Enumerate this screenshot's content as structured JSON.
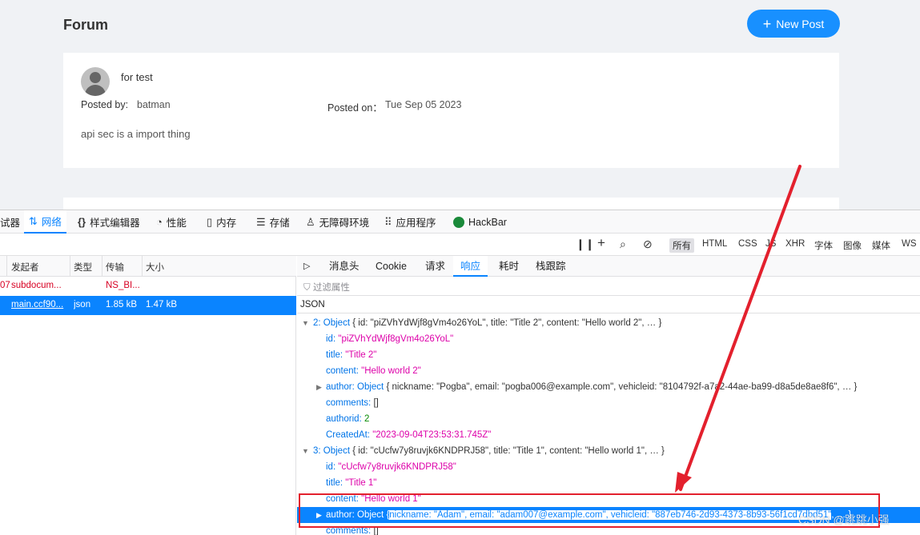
{
  "forum": {
    "title": "Forum",
    "new_post_label": "New Post",
    "post": {
      "title": "for test",
      "posted_by_label": "Posted by:",
      "author": "batman",
      "posted_on_label": "Posted on：",
      "date": "Tue Sep 05 2023",
      "body": "api sec is a import thing"
    }
  },
  "devtools": {
    "tabs": [
      {
        "label": "试器",
        "icon": "debugger-icon"
      },
      {
        "label": "网络",
        "icon": "network-arrows-icon"
      },
      {
        "label": "样式编辑器",
        "icon": "braces-icon"
      },
      {
        "label": "性能",
        "icon": "gauge-icon"
      },
      {
        "label": "内存",
        "icon": "chip-icon"
      },
      {
        "label": "存储",
        "icon": "storage-icon"
      },
      {
        "label": "无障碍环境",
        "icon": "accessibility-icon"
      },
      {
        "label": "应用程序",
        "icon": "grid-icon"
      },
      {
        "label": "HackBar",
        "icon": "hackbar-icon"
      }
    ],
    "active_tab": "网络",
    "filter_types": [
      "所有",
      "HTML",
      "CSS",
      "JS",
      "XHR",
      "字体",
      "图像",
      "媒体",
      "WS"
    ],
    "selected_filter": "所有",
    "columns": [
      "发起者",
      "类型",
      "传输",
      "大小"
    ],
    "requests": [
      {
        "num": "07",
        "initiator": "subdocum...",
        "type": "",
        "transfer": "NS_BI...",
        "size": ""
      },
      {
        "num": "",
        "initiator": "main.ccf90...",
        "type": "json",
        "transfer": "1.85 kB",
        "size": "1.47 kB"
      }
    ],
    "panel_tabs": [
      "消息头",
      "Cookie",
      "请求",
      "响应",
      "耗时",
      "栈跟踪"
    ],
    "active_panel_tab": "响应",
    "filter_placeholder": "过滤属性",
    "json_label": "JSON",
    "json_lines": {
      "l1": {
        "key": "2: Object",
        "summary": "{ id: \"piZVhYdWjf8gVm4o26YoL\", title: \"Title 2\", content: \"Hello world 2\", … }"
      },
      "l2": {
        "key": "id:",
        "val": "\"piZVhYdWjf8gVm4o26YoL\""
      },
      "l3": {
        "key": "title:",
        "val": "\"Title 2\""
      },
      "l4": {
        "key": "content:",
        "val": "\"Hello world 2\""
      },
      "l5": {
        "key": "author: Object",
        "summary": "{ nickname: \"Pogba\", email: \"pogba006@example.com\", vehicleid: \"8104792f-a7a2-44ae-ba99-d8a5de8ae8f6\", … }"
      },
      "l6": {
        "key": "comments:",
        "val": "[]"
      },
      "l7": {
        "key": "authorid:",
        "val": "2"
      },
      "l8": {
        "key": "CreatedAt:",
        "val": "\"2023-09-04T23:53:31.745Z\""
      },
      "l9": {
        "key": "3: Object",
        "summary": "{ id: \"cUcfw7y8ruvjk6KNDPRJ58\", title: \"Title 1\", content: \"Hello world 1\", … }"
      },
      "l10": {
        "key": "id:",
        "val": "\"cUcfw7y8ruvjk6KNDPRJ58\""
      },
      "l11": {
        "key": "title:",
        "val": "\"Title 1\""
      },
      "l12": {
        "key": "content:",
        "val": "\"Hello world 1\""
      },
      "l13": {
        "key": "author: Object",
        "brace": "{",
        "highlighted": "nickname: \"Adam\", email: \"adam007@example.com\", vehicleid: \"887eb746-2d93-4373-8b93-56f1cd7dbd51\"",
        "tail": ", … }"
      },
      "l14": {
        "key": "comments:",
        "val": "[]"
      }
    }
  },
  "annotation": {
    "arrow_color": "#e3202d",
    "box_color": "#e3202d"
  },
  "watermark": "CSDN @跳跳小强"
}
